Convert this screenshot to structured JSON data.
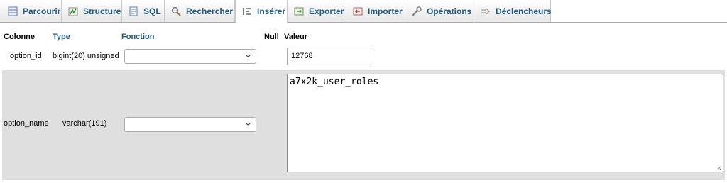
{
  "tabs": [
    {
      "label": "Parcourir",
      "icon": "browse-icon"
    },
    {
      "label": "Structure",
      "icon": "structure-icon"
    },
    {
      "label": "SQL",
      "icon": "sql-icon"
    },
    {
      "label": "Rechercher",
      "icon": "search-icon"
    },
    {
      "label": "Insérer",
      "icon": "insert-icon",
      "active": true
    },
    {
      "label": "Exporter",
      "icon": "export-icon"
    },
    {
      "label": "Importer",
      "icon": "import-icon"
    },
    {
      "label": "Opérations",
      "icon": "wrench-icon"
    },
    {
      "label": "Déclencheurs",
      "icon": "triggers-icon"
    }
  ],
  "table": {
    "headers": {
      "column": "Colonne",
      "type": "Type",
      "function": "Fonction",
      "null": "Null",
      "value": "Valeur"
    },
    "rows": [
      {
        "column": "option_id",
        "type": "bigint(20) unsigned",
        "function": "",
        "value": "12768"
      },
      {
        "column": "option_name",
        "type": "varchar(191)",
        "function": "",
        "value": "a7x2k_user_roles"
      }
    ]
  },
  "colors": {
    "link": "#235a81",
    "row_alt": "#dfdfdf"
  }
}
